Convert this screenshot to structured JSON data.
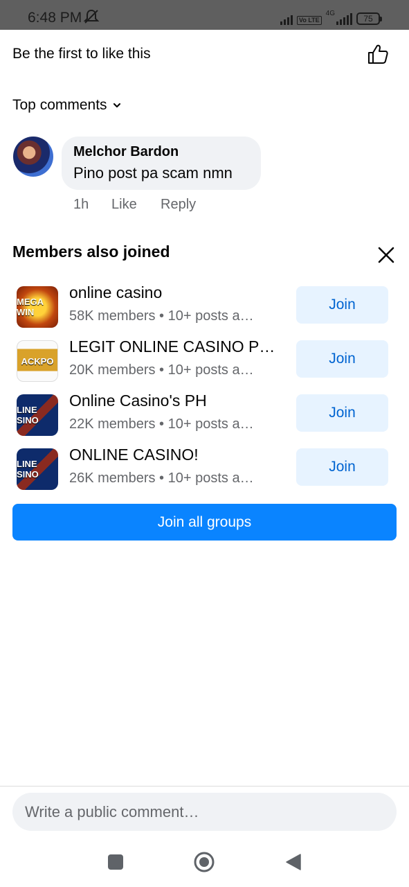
{
  "status_bar": {
    "time": "6:48 PM",
    "network": "4G",
    "volte": "Vo LTE",
    "battery": "75"
  },
  "post": {
    "likes_text": "Be the first to like this"
  },
  "comments": {
    "sort_label": "Top comments",
    "items": [
      {
        "author": "Melchor Bardon",
        "text": "Pino post pa scam nmn",
        "time": "1h",
        "like_label": "Like",
        "reply_label": "Reply"
      }
    ]
  },
  "suggestions": {
    "title": "Members also joined",
    "join_label": "Join",
    "join_all_label": "Join all groups",
    "groups": [
      {
        "name": "online casino",
        "meta": "58K members • 10+ posts a…",
        "icon_text": "MEGA WIN"
      },
      {
        "name": "LEGIT ONLINE CASINO P…",
        "meta": "20K members • 10+ posts a…",
        "icon_text": "ACKPO"
      },
      {
        "name": "Online Casino's PH",
        "meta": "22K members • 10+ posts a…",
        "icon_text": "LINE SINO"
      },
      {
        "name": "ONLINE CASINO!",
        "meta": "26K members • 10+ posts a…",
        "icon_text": "LINE SINO"
      }
    ]
  },
  "composer": {
    "placeholder": "Write a public comment…"
  },
  "colors": {
    "primary": "#0a84ff",
    "join_bg": "#e7f3ff",
    "join_text": "#0064d1",
    "secondary_text": "#65676b",
    "bubble_bg": "#f0f2f5"
  }
}
